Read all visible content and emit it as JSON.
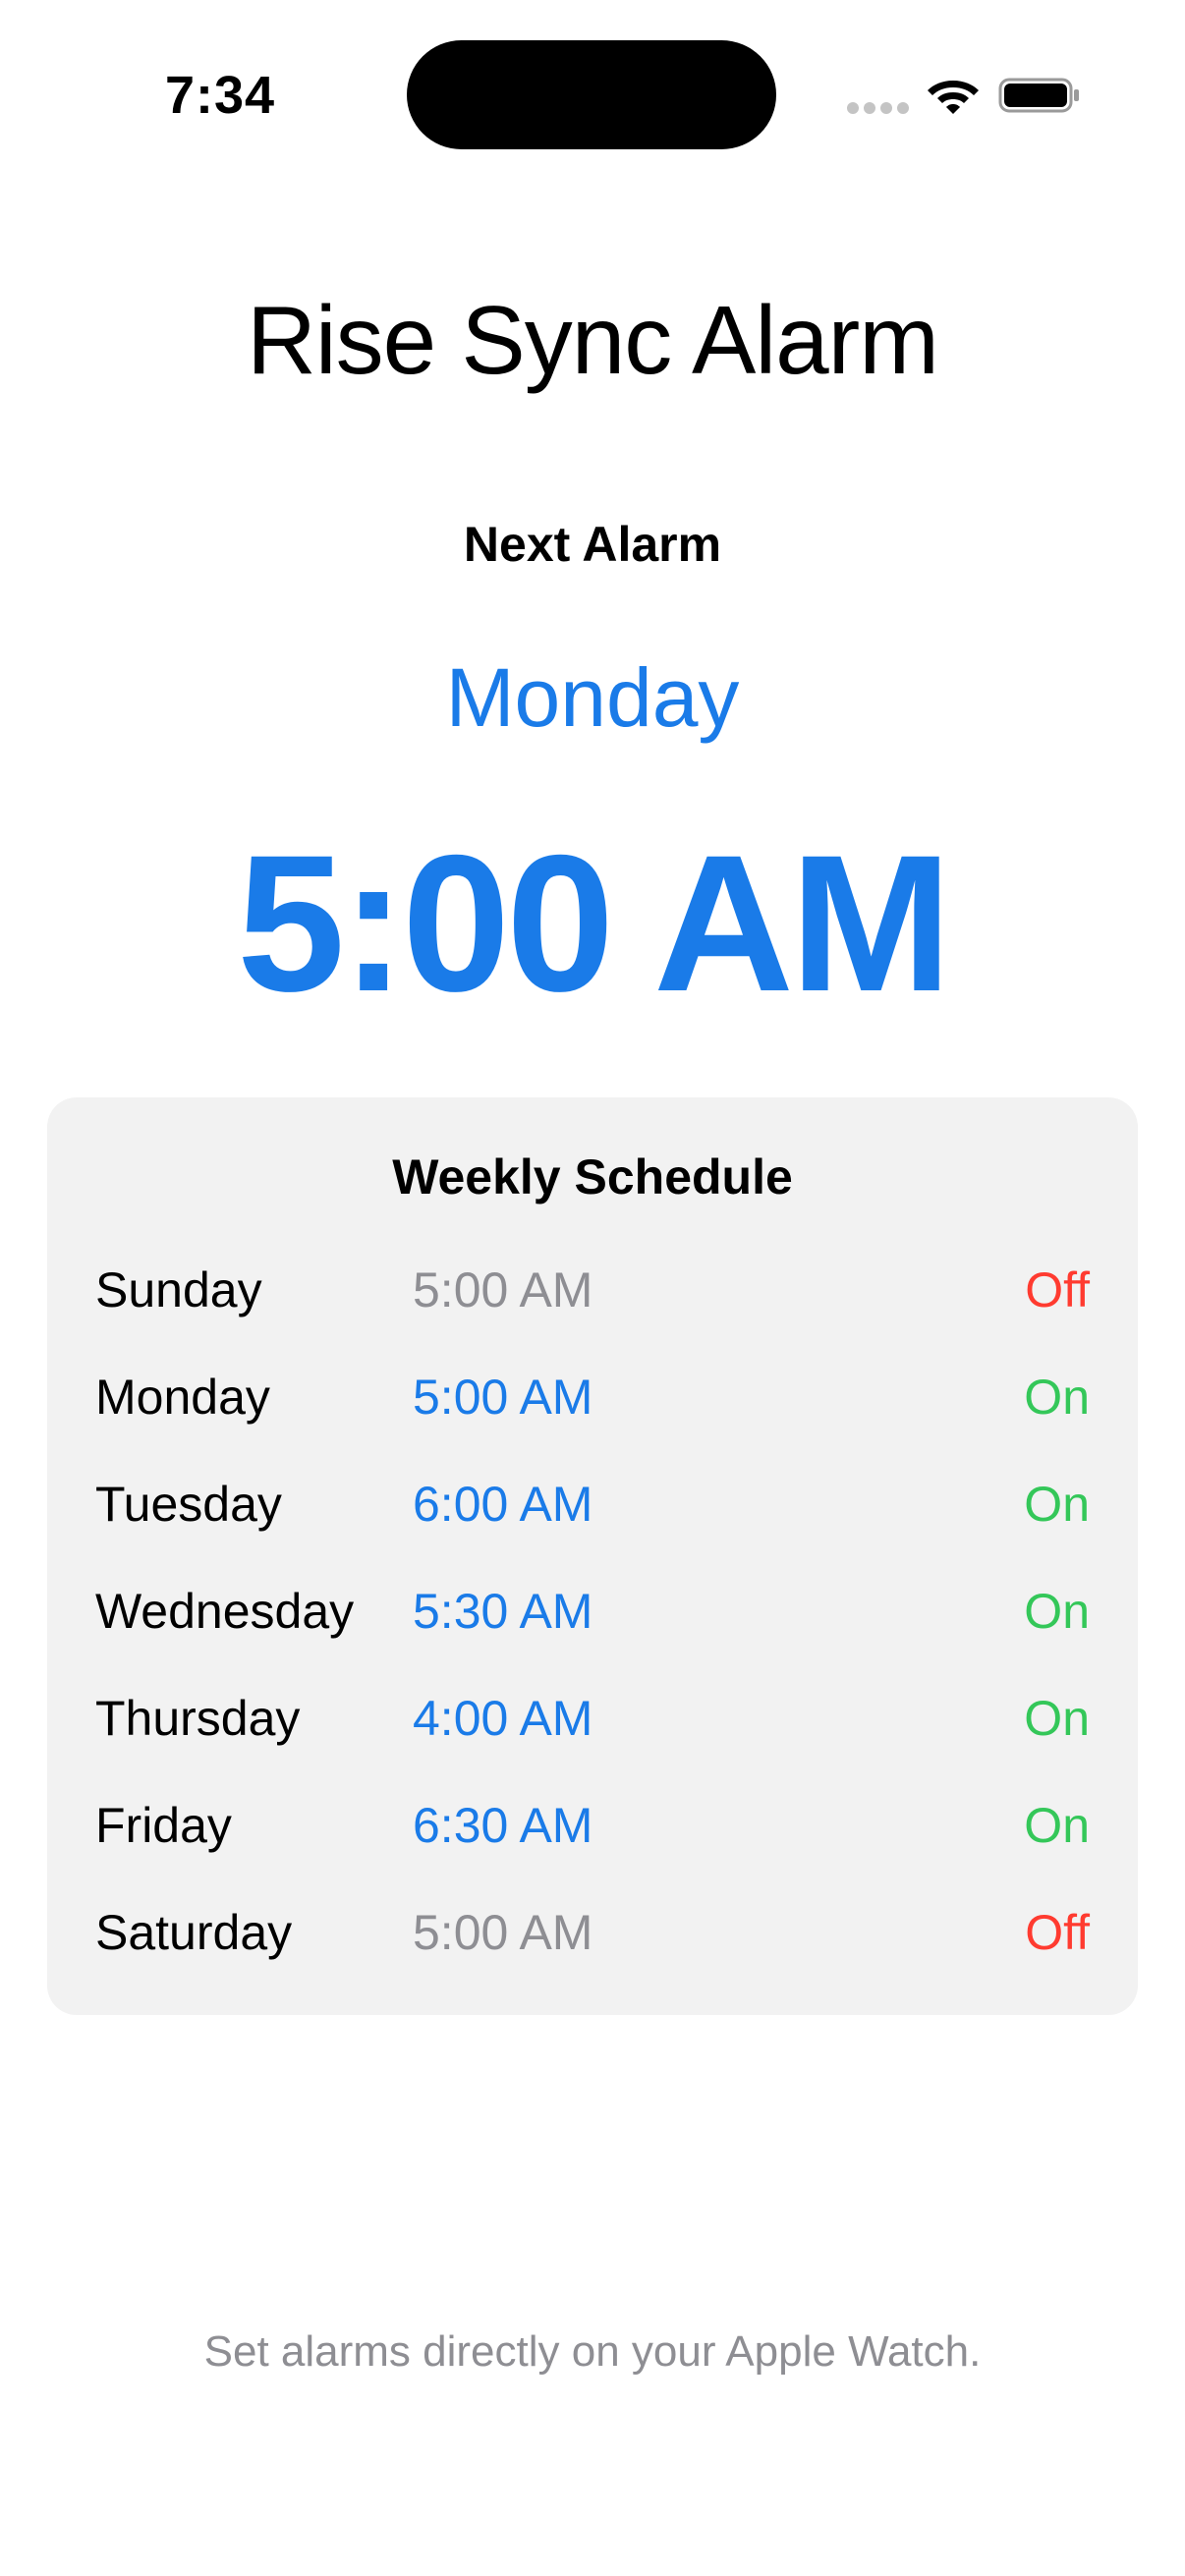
{
  "status_bar": {
    "time": "7:34",
    "icons": [
      "cellular-signal-icon",
      "wifi-icon",
      "battery-icon"
    ]
  },
  "app": {
    "title": "Rise Sync Alarm"
  },
  "next_alarm": {
    "label": "Next Alarm",
    "day": "Monday",
    "time": "5:00 AM"
  },
  "schedule": {
    "title": "Weekly Schedule",
    "rows": [
      {
        "day": "Sunday",
        "time": "5:00 AM",
        "status": "Off",
        "enabled": false
      },
      {
        "day": "Monday",
        "time": "5:00 AM",
        "status": "On",
        "enabled": true
      },
      {
        "day": "Tuesday",
        "time": "6:00 AM",
        "status": "On",
        "enabled": true
      },
      {
        "day": "Wednesday",
        "time": "5:30 AM",
        "status": "On",
        "enabled": true
      },
      {
        "day": "Thursday",
        "time": "4:00 AM",
        "status": "On",
        "enabled": true
      },
      {
        "day": "Friday",
        "time": "6:30 AM",
        "status": "On",
        "enabled": true
      },
      {
        "day": "Saturday",
        "time": "5:00 AM",
        "status": "Off",
        "enabled": false
      }
    ]
  },
  "footer": {
    "note": "Set alarms directly on your Apple Watch."
  },
  "colors": {
    "accent": "#1a7be8",
    "on": "#34c759",
    "off": "#ff3b30",
    "muted": "#8e8e93",
    "card": "#f2f2f2"
  }
}
